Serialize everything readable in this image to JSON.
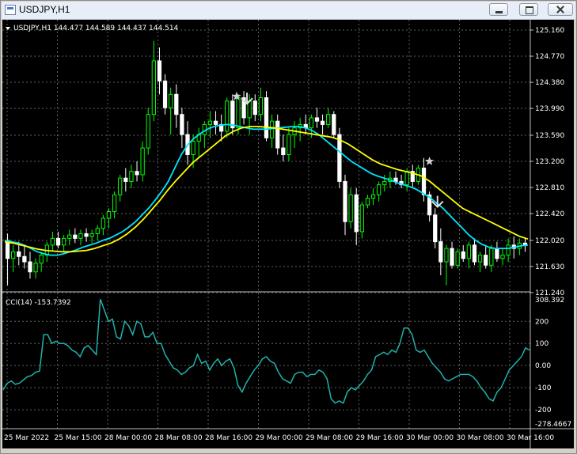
{
  "window": {
    "title": "USDJPY,H1"
  },
  "chart_header": {
    "text": "USDJPY,H1  144.477 144.589 144.437 144.514"
  },
  "cci_header": {
    "text": "CCI(14) -153.7392"
  },
  "colors": {
    "bull": "#00ff00",
    "bear": "#ffffff",
    "ma_fast": "#00e5ff",
    "ma_slow": "#ffff00",
    "cci": "#20b2aa",
    "grid": "#606060"
  },
  "chart_data": [
    {
      "type": "candlestick",
      "title": "USDJPY,H1",
      "ylim": [
        121.24,
        125.16
      ],
      "price_ticks": [
        "125.160",
        "124.770",
        "124.380",
        "123.990",
        "123.590",
        "123.200",
        "122.810",
        "122.420",
        "122.020",
        "121.630",
        "121.240"
      ],
      "series": [
        {
          "name": "",
          "kind": "candles",
          "ohlc": [
            [
              122.02,
              122.12,
              121.35,
              121.75
            ],
            [
              121.75,
              121.95,
              121.55,
              121.85
            ],
            [
              121.85,
              122.0,
              121.65,
              121.78
            ],
            [
              121.78,
              121.95,
              121.6,
              121.7
            ],
            [
              121.7,
              121.85,
              121.45,
              121.55
            ],
            [
              121.55,
              121.75,
              121.45,
              121.68
            ],
            [
              121.68,
              121.85,
              121.55,
              121.8
            ],
            [
              121.8,
              122.0,
              121.7,
              121.95
            ],
            [
              121.95,
              122.15,
              121.85,
              122.05
            ],
            [
              122.05,
              122.15,
              121.9,
              121.95
            ],
            [
              121.95,
              122.1,
              121.85,
              122.05
            ],
            [
              122.05,
              122.18,
              121.95,
              122.1
            ],
            [
              122.1,
              122.2,
              121.98,
              122.05
            ],
            [
              122.05,
              122.18,
              121.95,
              122.12
            ],
            [
              122.12,
              122.2,
              122.0,
              122.08
            ],
            [
              122.08,
              122.18,
              121.98,
              122.12
            ],
            [
              122.12,
              122.25,
              122.02,
              122.2
            ],
            [
              122.2,
              122.4,
              122.1,
              122.35
            ],
            [
              122.35,
              122.5,
              122.2,
              122.45
            ],
            [
              122.45,
              122.75,
              122.35,
              122.7
            ],
            [
              122.7,
              123.0,
              122.6,
              122.95
            ],
            [
              122.95,
              123.1,
              122.75,
              122.9
            ],
            [
              122.9,
              123.15,
              122.8,
              123.05
            ],
            [
              123.05,
              123.2,
              122.9,
              123.0
            ],
            [
              123.0,
              123.5,
              122.9,
              123.4
            ],
            [
              123.4,
              124.0,
              123.3,
              123.9
            ],
            [
              123.9,
              125.0,
              123.8,
              124.7
            ],
            [
              124.7,
              124.9,
              124.2,
              124.4
            ],
            [
              124.4,
              124.5,
              123.9,
              124.0
            ],
            [
              124.0,
              124.3,
              123.6,
              124.2
            ],
            [
              124.2,
              124.35,
              123.7,
              123.9
            ],
            [
              123.9,
              124.0,
              123.4,
              123.6
            ],
            [
              123.6,
              123.8,
              123.15,
              123.3
            ],
            [
              123.3,
              123.6,
              123.1,
              123.5
            ],
            [
              123.5,
              123.7,
              123.25,
              123.6
            ],
            [
              123.6,
              123.8,
              123.4,
              123.75
            ],
            [
              123.75,
              123.95,
              123.55,
              123.8
            ],
            [
              123.8,
              123.95,
              123.6,
              123.75
            ],
            [
              123.75,
              123.9,
              123.5,
              123.65
            ],
            [
              123.65,
              124.15,
              123.55,
              124.1
            ],
            [
              124.1,
              124.2,
              123.6,
              123.7
            ],
            [
              123.7,
              124.2,
              123.6,
              124.15
            ],
            [
              124.15,
              124.25,
              123.75,
              123.85
            ],
            [
              123.85,
              124.2,
              123.6,
              124.1
            ],
            [
              124.1,
              124.2,
              123.8,
              123.9
            ],
            [
              123.9,
              124.3,
              123.8,
              124.15
            ],
            [
              124.15,
              124.25,
              123.5,
              123.55
            ],
            [
              123.55,
              123.9,
              123.4,
              123.8
            ],
            [
              123.8,
              123.9,
              123.3,
              123.4
            ],
            [
              123.4,
              123.6,
              123.2,
              123.3
            ],
            [
              123.3,
              123.7,
              123.2,
              123.6
            ],
            [
              123.6,
              123.8,
              123.4,
              123.7
            ],
            [
              123.7,
              123.85,
              123.5,
              123.75
            ],
            [
              123.75,
              123.9,
              123.6,
              123.7
            ],
            [
              123.7,
              123.9,
              123.55,
              123.85
            ],
            [
              123.85,
              124.0,
              123.7,
              123.8
            ],
            [
              123.8,
              123.9,
              123.6,
              123.75
            ],
            [
              123.75,
              124.0,
              123.7,
              123.9
            ],
            [
              123.9,
              123.95,
              123.55,
              123.6
            ],
            [
              123.6,
              123.7,
              122.8,
              122.9
            ],
            [
              122.9,
              123.0,
              122.1,
              122.3
            ],
            [
              122.3,
              122.8,
              122.2,
              122.7
            ],
            [
              122.7,
              122.8,
              121.95,
              122.15
            ],
            [
              122.15,
              122.6,
              122.05,
              122.55
            ],
            [
              122.55,
              122.7,
              122.5,
              122.65
            ],
            [
              122.65,
              122.8,
              122.55,
              122.7
            ],
            [
              122.7,
              122.9,
              122.6,
              122.85
            ],
            [
              122.85,
              123.0,
              122.75,
              122.9
            ],
            [
              122.9,
              123.05,
              122.8,
              122.95
            ],
            [
              122.95,
              123.05,
              122.85,
              122.9
            ],
            [
              122.9,
              123.0,
              122.8,
              122.85
            ],
            [
              122.85,
              123.1,
              122.75,
              123.05
            ],
            [
              123.05,
              123.15,
              122.8,
              122.9
            ],
            [
              122.9,
              123.15,
              122.85,
              123.1
            ],
            [
              123.1,
              123.25,
              122.6,
              122.7
            ],
            [
              122.7,
              122.75,
              122.3,
              122.4
            ],
            [
              122.4,
              122.5,
              121.9,
              122.0
            ],
            [
              122.0,
              122.2,
              121.5,
              121.7
            ],
            [
              121.7,
              121.95,
              121.35,
              121.9
            ],
            [
              121.9,
              122.0,
              121.6,
              121.65
            ],
            [
              121.65,
              121.9,
              121.6,
              121.85
            ],
            [
              121.85,
              121.95,
              121.7,
              121.75
            ],
            [
              121.75,
              122.0,
              121.6,
              121.95
            ],
            [
              121.95,
              122.05,
              121.65,
              121.7
            ],
            [
              121.7,
              121.85,
              121.55,
              121.8
            ],
            [
              121.8,
              121.95,
              121.6,
              121.65
            ],
            [
              121.65,
              121.95,
              121.55,
              121.9
            ],
            [
              121.9,
              122.0,
              121.7,
              121.75
            ],
            [
              121.75,
              121.9,
              121.65,
              121.8
            ],
            [
              121.8,
              122.05,
              121.7,
              121.95
            ],
            [
              121.95,
              122.08,
              121.75,
              121.9
            ],
            [
              121.9,
              122.05,
              121.8,
              121.98
            ],
            [
              121.98,
              122.05,
              121.85,
              121.95
            ]
          ]
        },
        {
          "name": "",
          "kind": "ma",
          "values": [
            122.02,
            122.0,
            121.98,
            121.95,
            121.9,
            121.85,
            121.82,
            121.8,
            121.8,
            121.82,
            121.85,
            121.88,
            121.92,
            121.95,
            121.98,
            122.02,
            122.05,
            122.1,
            122.15,
            122.22,
            122.3,
            122.4,
            122.5,
            122.62,
            122.75,
            122.9,
            123.1,
            123.3,
            123.45,
            123.55,
            123.62,
            123.68,
            123.72,
            123.74,
            123.75,
            123.74,
            123.72,
            123.7,
            123.68,
            123.68,
            123.68,
            123.69,
            123.7,
            123.71,
            123.72,
            123.72,
            123.7,
            123.66,
            123.6,
            123.52,
            123.44,
            123.36,
            123.28,
            123.2,
            123.14,
            123.08,
            123.02,
            122.98,
            122.95,
            122.92,
            122.88,
            122.85,
            122.82,
            122.78,
            122.72,
            122.66,
            122.58,
            122.5,
            122.4,
            122.3,
            122.2,
            122.1,
            122.02,
            121.96,
            121.92,
            121.9,
            121.9,
            121.9,
            121.92,
            121.94,
            121.95
          ]
        },
        {
          "name": "",
          "kind": "ma",
          "values": [
            122.0,
            121.98,
            121.95,
            121.92,
            121.89,
            121.87,
            121.86,
            121.85,
            121.85,
            121.86,
            121.87,
            121.9,
            121.94,
            121.98,
            122.04,
            122.12,
            122.22,
            122.34,
            122.48,
            122.62,
            122.78,
            122.92,
            123.05,
            123.18,
            123.28,
            123.38,
            123.48,
            123.58,
            123.65,
            123.7,
            123.72,
            123.72,
            123.71,
            123.7,
            123.68,
            123.66,
            123.64,
            123.62,
            123.6,
            123.58,
            123.56,
            123.52,
            123.46,
            123.38,
            123.3,
            123.22,
            123.16,
            123.12,
            123.08,
            123.05,
            123.02,
            122.98,
            122.9,
            122.8,
            122.7,
            122.6,
            122.5,
            122.44,
            122.38,
            122.32,
            122.26,
            122.2,
            122.14,
            122.08,
            122.04
          ]
        }
      ],
      "annotations": [
        "star",
        "down-arrow",
        "star",
        "down-arrow"
      ]
    },
    {
      "type": "line",
      "title": "CCI(14) -153.7392",
      "ylim": [
        -278.4667,
        308.392
      ],
      "y_ticks": [
        "308.392",
        "200",
        "100",
        "0.00",
        "-100",
        "-200",
        "-278.4667"
      ],
      "x": [
        "25 Mar 2022",
        "25 Mar 15:00",
        "28 Mar 00:00",
        "28 Mar 08:00",
        "28 Mar 16:00",
        "29 Mar 00:00",
        "29 Mar 08:00",
        "29 Mar 16:00",
        "30 Mar 00:00",
        "30 Mar 08:00",
        "30 Mar 16:00"
      ],
      "series": [
        {
          "name": "",
          "values": [
            -110,
            -80,
            -70,
            -85,
            -80,
            -65,
            -50,
            -45,
            -30,
            -25,
            140,
            140,
            100,
            110,
            100,
            100,
            90,
            70,
            60,
            40,
            80,
            90,
            70,
            50,
            300,
            250,
            200,
            210,
            130,
            120,
            200,
            180,
            140,
            200,
            190,
            130,
            130,
            150,
            100,
            100,
            50,
            20,
            -10,
            -20,
            -40,
            -30,
            -10,
            0,
            50,
            10,
            20,
            -20,
            10,
            30,
            0,
            20,
            30,
            -10,
            -90,
            -120,
            -80,
            -50,
            -20,
            0,
            30,
            40,
            20,
            10,
            -30,
            -60,
            -70,
            -80,
            -40,
            -30,
            -30,
            -50,
            -40,
            -40,
            -20,
            -30,
            -60,
            -150,
            -170,
            -160,
            -170,
            -120,
            -100,
            -110,
            -90,
            -70,
            -40,
            -20,
            40,
            50,
            60,
            50,
            70,
            60,
            100,
            170,
            170,
            140,
            70,
            60,
            70,
            40,
            10,
            -10,
            -30,
            -60,
            -70,
            -60,
            -50,
            -40,
            -40,
            -40,
            -50,
            -70,
            -100,
            -120,
            -150,
            -160,
            -120,
            -100,
            -60,
            -20,
            0,
            20,
            40,
            80,
            70
          ]
        }
      ]
    }
  ]
}
